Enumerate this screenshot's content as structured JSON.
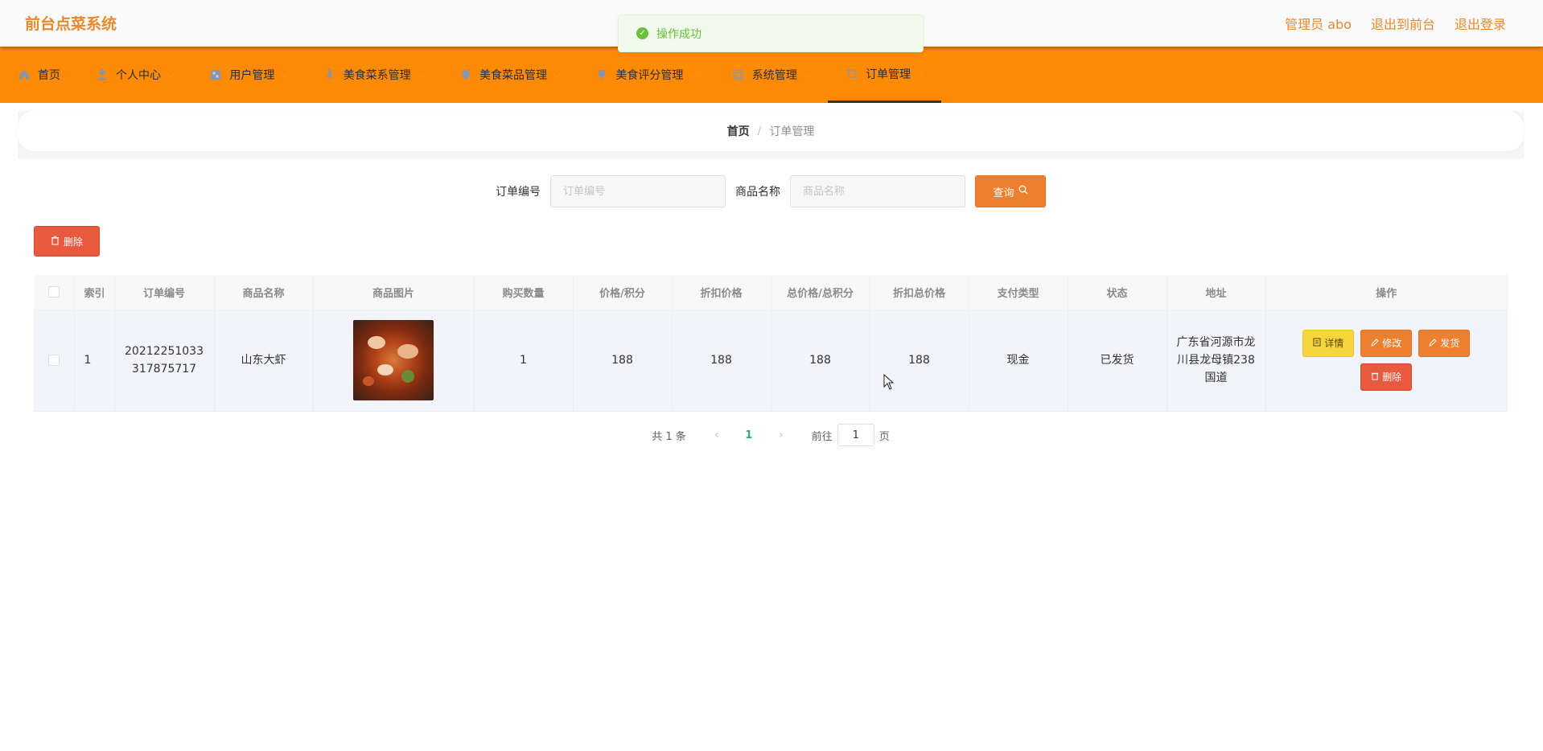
{
  "app": {
    "title": "前台点菜系统"
  },
  "header": {
    "user_label": "管理员 abo",
    "exit_front_label": "退出到前台",
    "logout_label": "退出登录"
  },
  "toast": {
    "message": "操作成功"
  },
  "nav": {
    "items": [
      {
        "label": "首页",
        "icon": "home-icon"
      },
      {
        "label": "个人中心",
        "icon": "user-icon"
      },
      {
        "label": "用户管理",
        "icon": "grid-icon"
      },
      {
        "label": "美食菜系管理",
        "icon": "mic-icon"
      },
      {
        "label": "美食菜品管理",
        "icon": "location-icon"
      },
      {
        "label": "美食评分管理",
        "icon": "pin-icon"
      },
      {
        "label": "系统管理",
        "icon": "copy-icon"
      },
      {
        "label": "订单管理",
        "icon": "crop-icon"
      }
    ]
  },
  "breadcrumb": {
    "home": "首页",
    "separator": "/",
    "current": "订单管理"
  },
  "search": {
    "order_no_label": "订单编号",
    "order_no_placeholder": "订单编号",
    "goods_name_label": "商品名称",
    "goods_name_placeholder": "商品名称",
    "query_label": "查询"
  },
  "toolbar": {
    "delete_label": "删除"
  },
  "table": {
    "headers": {
      "index": "索引",
      "order_no": "订单编号",
      "goods_name": "商品名称",
      "goods_image": "商品图片",
      "quantity": "购买数量",
      "price": "价格/积分",
      "discount_price": "折扣价格",
      "total": "总价格/总积分",
      "discount_total": "折扣总价格",
      "pay_type": "支付类型",
      "status": "状态",
      "address": "地址",
      "actions": "操作"
    },
    "rows": [
      {
        "index": "1",
        "order_no": "20212251033317875717",
        "goods_name": "山东大虾",
        "quantity": "1",
        "price": "188",
        "discount_price": "188",
        "total": "188",
        "discount_total": "188",
        "pay_type": "现金",
        "status": "已发货",
        "address": "广东省河源市龙川县龙母镇238国道"
      }
    ],
    "actions": {
      "detail": "详情",
      "edit": "修改",
      "ship": "发货",
      "delete": "删除"
    }
  },
  "pagination": {
    "total": "共 1 条",
    "current_page": "1",
    "goto_label": "前往",
    "goto_value": "1",
    "page_suffix": "页"
  },
  "colors": {
    "brand": "#e8892e",
    "navbar": "#ff8a05",
    "primary_button": "#ee7f2f",
    "danger_button": "#e85a3d",
    "detail_button": "#f5d63d",
    "success": "#67c23a"
  }
}
